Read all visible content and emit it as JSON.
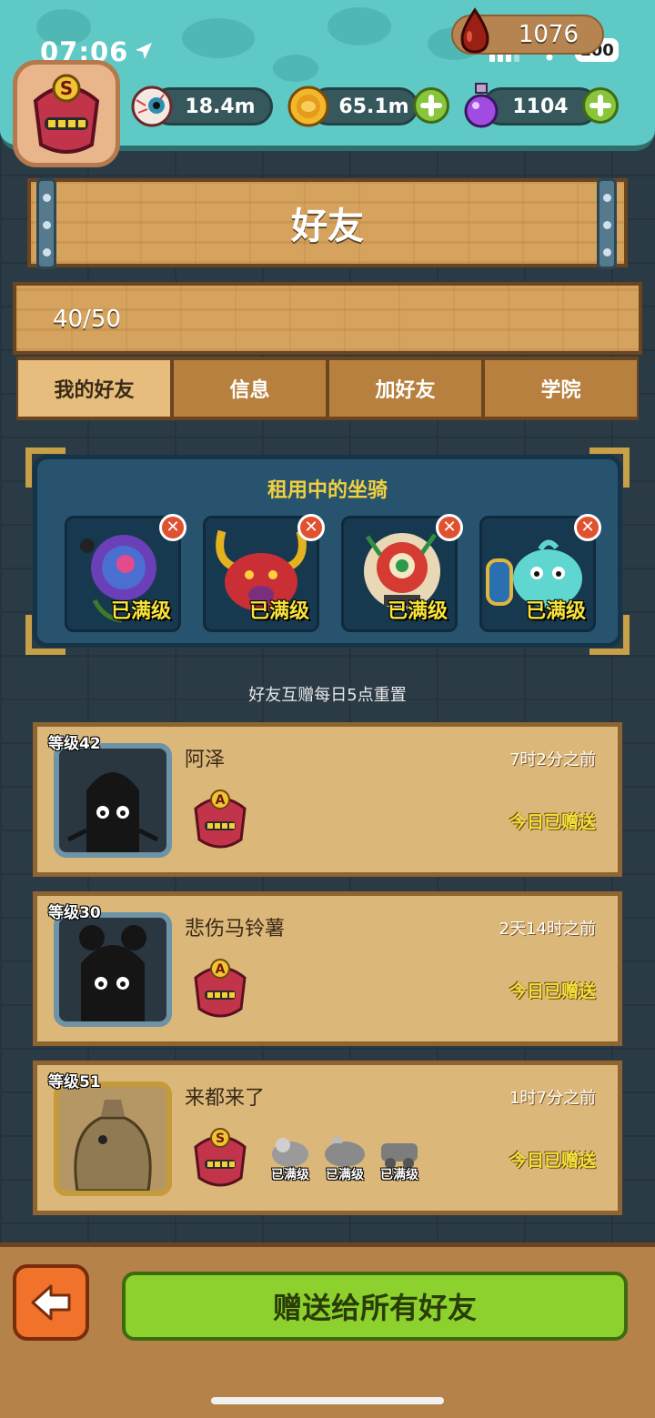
{
  "status_bar": {
    "time": "07:06",
    "battery": "100"
  },
  "resources": [
    {
      "icon": "eyeball-icon",
      "value": "18.4m",
      "has_plus": false
    },
    {
      "icon": "gold-coin-icon",
      "value": "65.1m",
      "has_plus": true
    },
    {
      "icon": "potion-icon",
      "value": "1104",
      "has_plus": true
    }
  ],
  "avatar": {
    "grade": "S"
  },
  "header": {
    "title": "好友"
  },
  "summary": {
    "friend_count": "40/50",
    "blood_value": "1076"
  },
  "tabs": [
    {
      "label": "我的好友",
      "active": true
    },
    {
      "label": "信息",
      "active": false
    },
    {
      "label": "加好友",
      "active": false
    },
    {
      "label": "学院",
      "active": false
    }
  ],
  "mounts": {
    "title": "租用中的坐骑",
    "items": [
      {
        "name": "purple-rose-mount",
        "status": "已满级"
      },
      {
        "name": "red-horned-demon-mount",
        "status": "已满级"
      },
      {
        "name": "lion-dance-mount",
        "status": "已满级"
      },
      {
        "name": "teal-blob-knight-mount",
        "status": "已满级"
      }
    ]
  },
  "daily_note": "好友互赠每日5点重置",
  "friends": [
    {
      "level": "等级42",
      "name": "阿泽",
      "time": "7时2分之前",
      "status": "今日已赠送",
      "badge": "A",
      "mounts": []
    },
    {
      "level": "等级30",
      "name": "悲伤马铃薯",
      "time": "2天14时之前",
      "status": "今日已赠送",
      "badge": "A",
      "mounts": []
    },
    {
      "level": "等级51",
      "name": "来都来了",
      "time": "1时7分之前",
      "status": "今日已赠送",
      "badge": "S",
      "mounts": [
        "已满级",
        "已满级",
        "已满级"
      ]
    }
  ],
  "footer": {
    "gift_all_label": "赠送给所有好友"
  },
  "colors": {
    "accent_green": "#8dd12e",
    "gold_text": "#f2cf3f",
    "teal_panel": "#5fc9c5",
    "wood": "#d6a35e"
  }
}
